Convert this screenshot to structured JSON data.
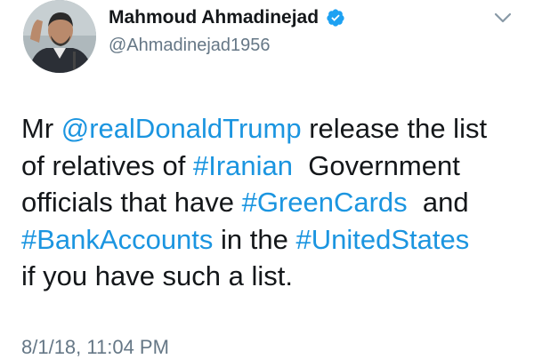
{
  "user": {
    "display_name": "Mahmoud Ahmadinejad",
    "username": "@Ahmadinejad1956",
    "verified": true
  },
  "tweet": {
    "lines": [
      [
        {
          "t": "Mr "
        },
        {
          "t": "@realDonaldTrump",
          "link": true
        },
        {
          "t": " release the list"
        }
      ],
      [
        {
          "t": "of relatives of "
        },
        {
          "t": "#Iranian",
          "link": true
        },
        {
          "t": "  Government"
        }
      ],
      [
        {
          "t": "officials that have "
        },
        {
          "t": "#GreenCards",
          "link": true
        },
        {
          "t": "  and"
        }
      ],
      [
        {
          "t": "#BankAccounts",
          "link": true
        },
        {
          "t": " in the "
        },
        {
          "t": "#UnitedStates",
          "link": true
        }
      ],
      [
        {
          "t": "if you have such a list."
        }
      ]
    ],
    "timestamp": "8/1/18, 11:04 PM"
  },
  "colors": {
    "link": "#1b95e0",
    "verified": "#1da1f2",
    "secondary_text": "#657786"
  },
  "icons": {
    "verified": "verified-badge-icon",
    "caret": "chevron-down-icon"
  }
}
